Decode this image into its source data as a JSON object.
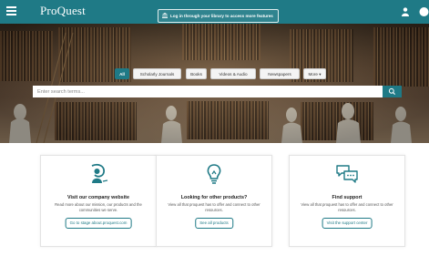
{
  "header": {
    "logo": "ProQuest",
    "login_label": "Log in through your library to access more features"
  },
  "search": {
    "tabs": [
      "All",
      "Scholarly Journals",
      "Books",
      "Videos & Audio",
      "Newspapers",
      "More"
    ],
    "placeholder": "Enter search terms..."
  },
  "cards": [
    {
      "title": "Visit our company website",
      "description": "Read more about our mission, our products and the communities we serve.",
      "button": "Go to stage about.proquest.com"
    },
    {
      "title": "Looking for other products?",
      "description": "View all that proquest has to offer and connect to other resources.",
      "button": "See all products"
    },
    {
      "title": "Find support",
      "description": "View all that proquest has to offer and connect to other resources.",
      "button": "Visit the support center"
    }
  ],
  "colors": {
    "brand": "#1f7a86"
  },
  "icons": [
    "menu-icon",
    "user-icon",
    "more-icon",
    "library-icon",
    "search-icon",
    "chat-person-icon",
    "lightbulb-icon",
    "speech-bubbles-icon"
  ]
}
